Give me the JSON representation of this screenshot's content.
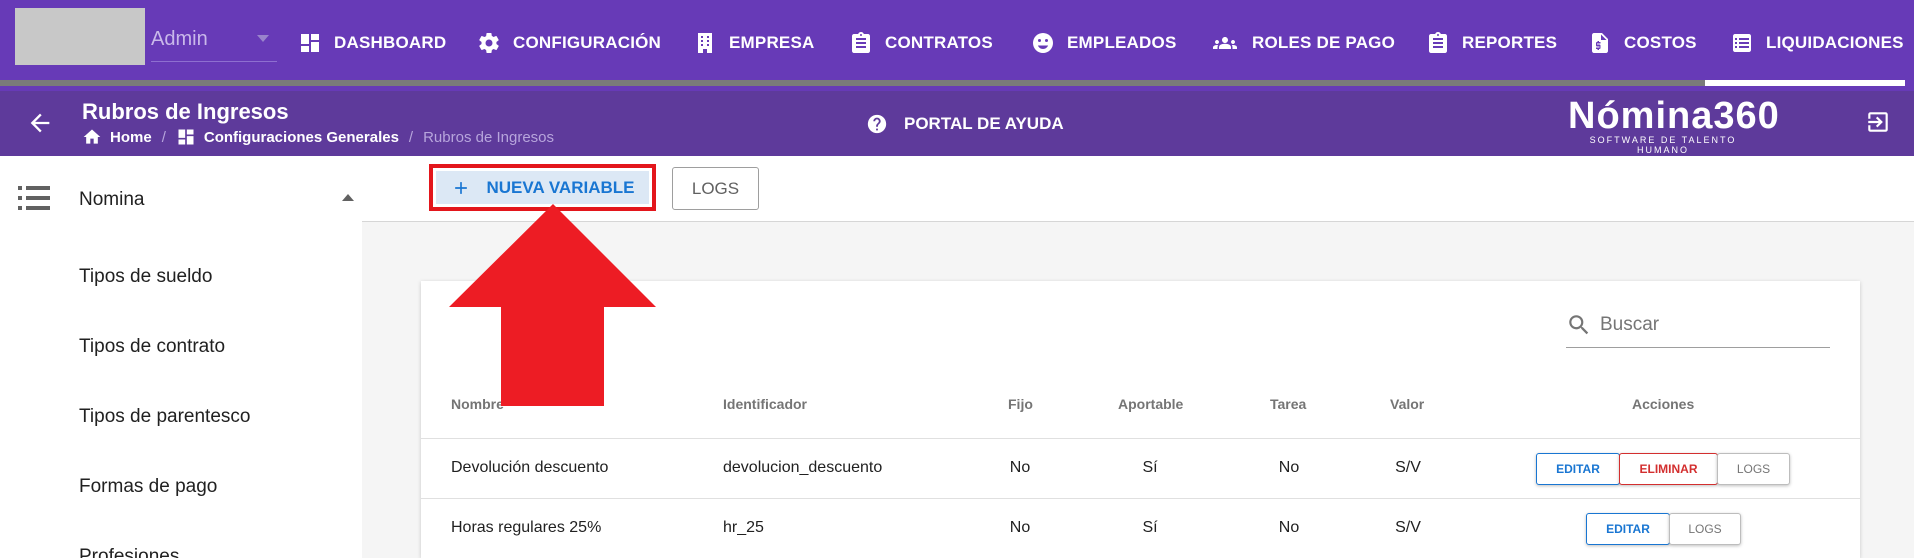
{
  "topbar": {
    "user_label": "Admin",
    "nav": [
      {
        "label": "DASHBOARD",
        "icon": "dashboard-icon"
      },
      {
        "label": "CONFIGURACIÓN",
        "icon": "gear-icon"
      },
      {
        "label": "EMPRESA",
        "icon": "building-icon"
      },
      {
        "label": "CONTRATOS",
        "icon": "clipboard-icon"
      },
      {
        "label": "EMPLEADOS",
        "icon": "face-icon"
      },
      {
        "label": "ROLES DE PAGO",
        "icon": "people-icon"
      },
      {
        "label": "REPORTES",
        "icon": "clipboard-icon"
      },
      {
        "label": "COSTOS",
        "icon": "invoice-icon"
      },
      {
        "label": "LIQUIDACIONES",
        "icon": "list-icon"
      }
    ]
  },
  "subbar": {
    "title": "Rubros de Ingresos",
    "breadcrumb": {
      "home": "Home",
      "section": "Configuraciones Generales",
      "current": "Rubros de Ingresos",
      "separator": "/"
    },
    "help_label": "PORTAL DE AYUDA",
    "brand_name": "Nómina360",
    "brand_tagline": "SOFTWARE DE TALENTO HUMANO"
  },
  "sidebar": {
    "section_label": "Nomina",
    "items": [
      "Tipos de sueldo",
      "Tipos de contrato",
      "Tipos de parentesco",
      "Formas de pago",
      "Profesiones"
    ]
  },
  "toolbar": {
    "new_label": "NUEVA VARIABLE",
    "logs_label": "LOGS"
  },
  "search": {
    "placeholder": "Buscar"
  },
  "table": {
    "headers": {
      "nombre": "Nombre",
      "identificador": "Identificador",
      "fijo": "Fijo",
      "aportable": "Aportable",
      "tarea": "Tarea",
      "valor": "Valor",
      "acciones": "Acciones"
    },
    "rows": [
      {
        "nombre": "Devolución descuento",
        "identificador": "devolucion_descuento",
        "fijo": "No",
        "aportable": "Sí",
        "tarea": "No",
        "valor": "S/V"
      },
      {
        "nombre": "Horas regulares 25%",
        "identificador": "hr_25",
        "fijo": "No",
        "aportable": "Sí",
        "tarea": "No",
        "valor": "S/V"
      }
    ],
    "actions": {
      "edit": "EDITAR",
      "delete": "ELIMINAR",
      "logs": "LOGS"
    }
  },
  "colors": {
    "topbar": "#673ab7",
    "subbar": "#5e3a9b",
    "primary_blue": "#1976d2",
    "danger_red": "#d32f2f",
    "highlight_red": "#e3161c"
  }
}
